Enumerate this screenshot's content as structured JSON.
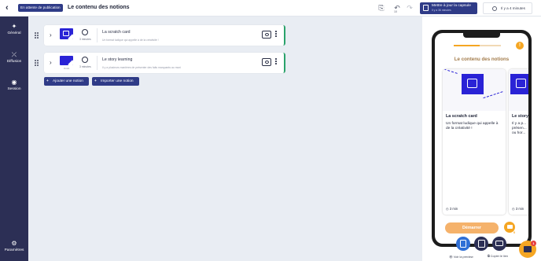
{
  "header": {
    "status_badge": "En attente de publication",
    "title": "Le contenu des notions",
    "undo_count": "10",
    "update_button": {
      "label": "Mettre à jour la capsule",
      "sublabel": "Il y a 36 minutes"
    },
    "last_saved": "Il y a 4 minutes"
  },
  "sidebar": {
    "items": [
      {
        "label": "Général",
        "icon": "wand-icon"
      },
      {
        "label": "Diffusion",
        "icon": "share-icon"
      },
      {
        "label": "Session",
        "icon": "session-icon"
      }
    ],
    "footer": {
      "label": "Paramètres",
      "icon": "gear-icon"
    }
  },
  "notions": [
    {
      "title": "La scratch card",
      "description": "Un format ludique qui appelle à de la créativité !",
      "duration": "3 minutes"
    },
    {
      "title": "Le story learning",
      "description": "Il y a plusieurs manières de présenter des faits marquants au moni",
      "duration": "3 minutes",
      "thumb_caption": "3 min"
    }
  ],
  "actions": {
    "add_notion": "Ajouter une notion",
    "import_notion": "Importer une notion"
  },
  "preview": {
    "screen_title": "Le contenu des notions",
    "progress": 0.55,
    "cards": [
      {
        "title": "La scratch card",
        "description": "Un format ludique qui appelle à de la créativité !",
        "duration": "3 min"
      },
      {
        "title": "Le story",
        "description": "Il y a p... présen... ou hor...",
        "duration": "3 min"
      }
    ],
    "start_button": "Démarrer",
    "chat_badge": "0",
    "devices": [
      "phone-icon",
      "tablet-icon",
      "laptop-icon"
    ],
    "links": {
      "view_preview": "Voir la preview",
      "copy_link": "Copier le lien"
    }
  },
  "chat": {
    "badge": "1"
  },
  "colors": {
    "navy": "#2f3b87",
    "sidebar": "#2c2f55",
    "accent_orange": "#f5a623",
    "green": "#2aa36b"
  }
}
